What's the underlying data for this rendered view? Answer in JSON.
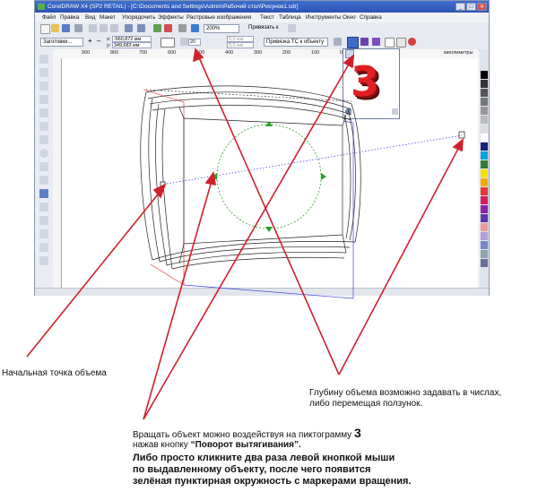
{
  "window": {
    "title": "CorelDRAW X4 (SP2 RETAIL) - [C:\\Documents and Settings\\Admin\\Рабочий стол\\Рисунок1.cdr]",
    "controls": [
      "_",
      "□",
      "✕"
    ]
  },
  "menu": [
    "Файл",
    "Правка",
    "Вид",
    "Макет",
    "Упорядочить",
    "Эффекты",
    "Растровые изображения",
    "Текст",
    "Таблица",
    "Инструменты",
    "Окно",
    "Справка"
  ],
  "toolbar": {
    "zoom_value": "200%",
    "snap_label": "Привязать к"
  },
  "property_bar": {
    "preset_value": "Заготовки...",
    "x_label": "x:",
    "x_value": "-660,872 мм",
    "y_label": "y:",
    "y_value": "349,683 мм",
    "depth_value": "20",
    "vanish_field_1": "0,0 мм",
    "vanish_field_2": "0,0 мм",
    "vanish_point_value": "Привязка ТС к объекту"
  },
  "ruler": {
    "ticks": [
      "900",
      "800",
      "700",
      "600",
      "500",
      "400",
      "300",
      "200",
      "100",
      "0",
      "100",
      "200"
    ],
    "units": "миллиметры"
  },
  "preset_popup": {
    "big_glyph": "3"
  },
  "annotations": {
    "start_point": "Начальная точка объема",
    "depth_line1": "Глубину объема  возможно задавать в числах,",
    "depth_line2": "либо перемещая ползунок.",
    "rotate_line1": "Вращать объект можно воздействуя на пиктограмму",
    "rotate_number": "3",
    "rotate_line2_pre": " нажав кнопку ",
    "rotate_line2_bold": "“Поворот вытягивания”.",
    "dbl_line1": "Либо просто кликните два раза левой кнопкой мыши",
    "dbl_line2": "по выдавленному объекту, после чего появится",
    "dbl_line3": "зелёная пунктирная окружность с маркерами вращения."
  },
  "colors": {
    "accent": "#2a54b0",
    "arrow": "#d0202a",
    "rotation_ring": "#2aa02a",
    "extrude_red": "#e02020"
  }
}
